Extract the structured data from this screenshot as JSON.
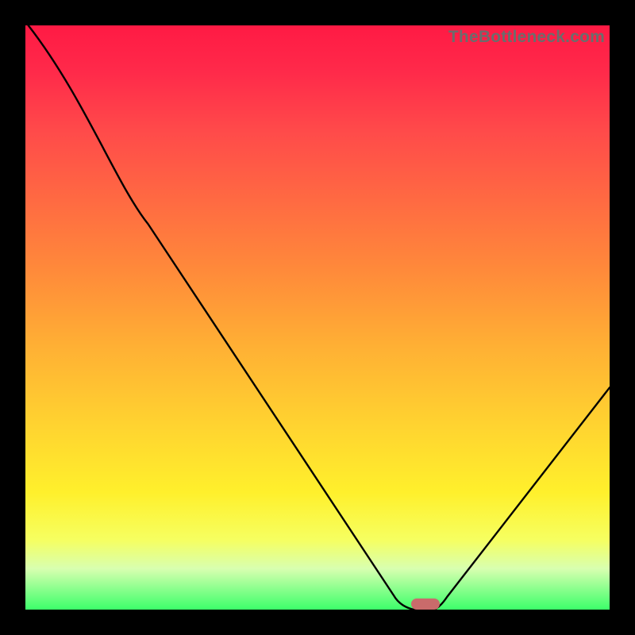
{
  "watermark": "TheBottleneck.com",
  "chart_data": {
    "type": "line",
    "title": "",
    "xlabel": "",
    "ylabel": "",
    "xlim": [
      0,
      1
    ],
    "ylim": [
      0,
      1
    ],
    "grid": false,
    "legend": false,
    "series": [
      {
        "name": "bottleneck-curve",
        "x": [
          0.005,
          0.21,
          0.63,
          0.665,
          0.7,
          1.0
        ],
        "values": [
          1.0,
          0.66,
          0.025,
          0.0,
          0.0,
          0.38
        ]
      }
    ],
    "marker": {
      "x": 0.685,
      "y": 0.01
    },
    "background_gradient": {
      "type": "linear-vertical",
      "stops": [
        {
          "pos": 0.0,
          "color": "#ff1a44"
        },
        {
          "pos": 0.5,
          "color": "#ffb034"
        },
        {
          "pos": 0.85,
          "color": "#fff02c"
        },
        {
          "pos": 1.0,
          "color": "#3cff6a"
        }
      ]
    }
  }
}
